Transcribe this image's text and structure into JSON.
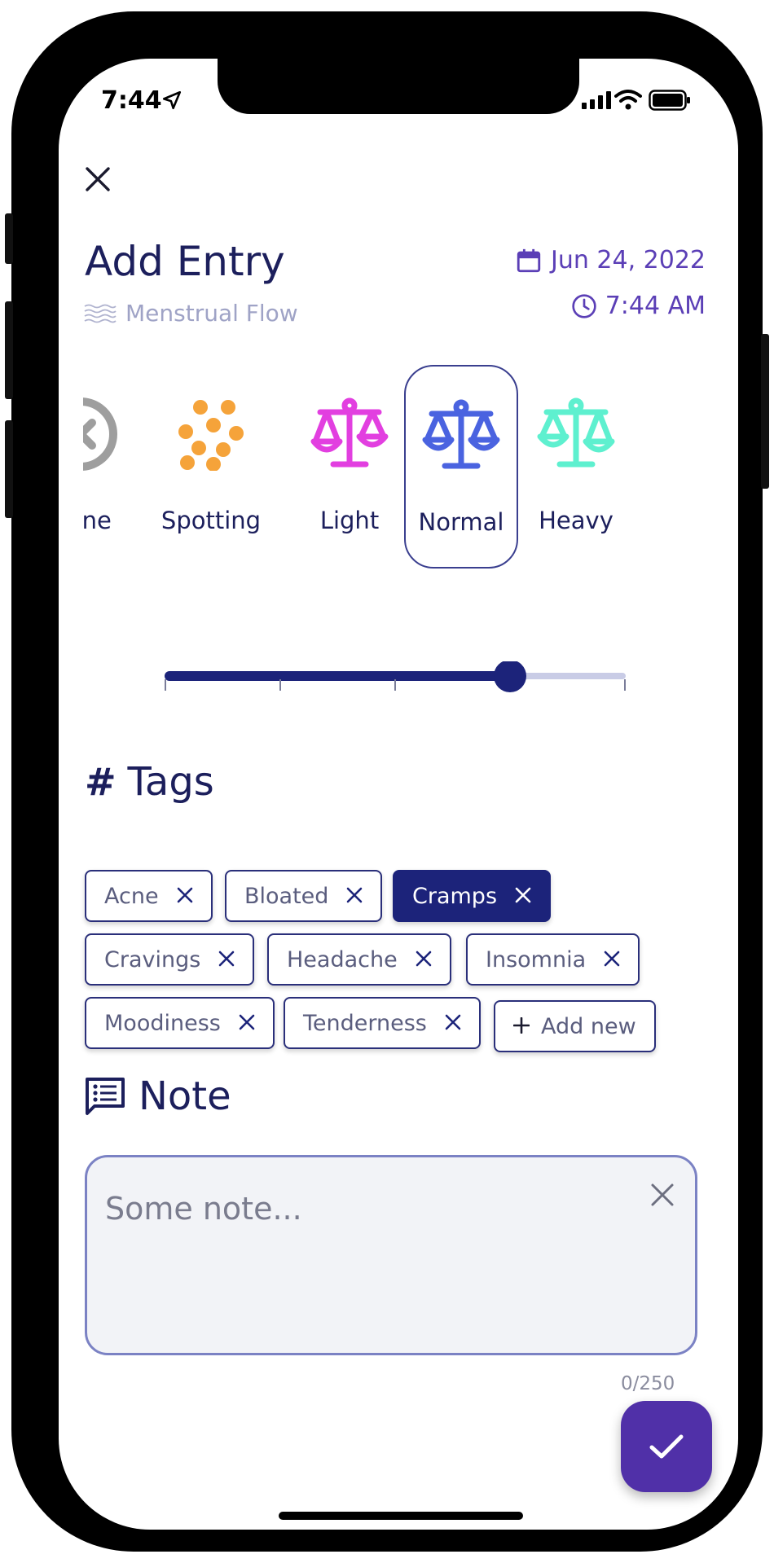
{
  "status_bar": {
    "time": "7:44"
  },
  "header": {
    "title": "Add Entry",
    "subtitle": "Menstrual Flow",
    "date": "Jun 24, 2022",
    "time": "7:44 AM"
  },
  "flow": {
    "options": [
      {
        "label": "None",
        "icon": "none-x-icon",
        "color": "#9e9e9e"
      },
      {
        "label": "Spotting",
        "icon": "dots-icon",
        "color": "#f5a33a"
      },
      {
        "label": "Light",
        "icon": "scale-icon",
        "color": "#e23fe0"
      },
      {
        "label": "Normal",
        "icon": "scale-icon",
        "color": "#4a63e0"
      },
      {
        "label": "Heavy",
        "icon": "scale-icon",
        "color": "#5ef0cf"
      }
    ],
    "selected": "Normal",
    "slider_level": 0.75
  },
  "tags": {
    "heading": "Tags",
    "items": [
      {
        "label": "Acne",
        "active": false
      },
      {
        "label": "Bloated",
        "active": false
      },
      {
        "label": "Cramps",
        "active": true
      },
      {
        "label": "Cravings",
        "active": false
      },
      {
        "label": "Headache",
        "active": false
      },
      {
        "label": "Insomnia",
        "active": false
      },
      {
        "label": "Moodiness",
        "active": false
      },
      {
        "label": "Tenderness",
        "active": false
      }
    ],
    "add_label": "Add new"
  },
  "note": {
    "heading": "Note",
    "placeholder": "Some note...",
    "value": "",
    "counter": "0/250"
  },
  "colors": {
    "primary": "#1c237a",
    "accent": "#5030a8",
    "text": "#1c1f5c"
  }
}
